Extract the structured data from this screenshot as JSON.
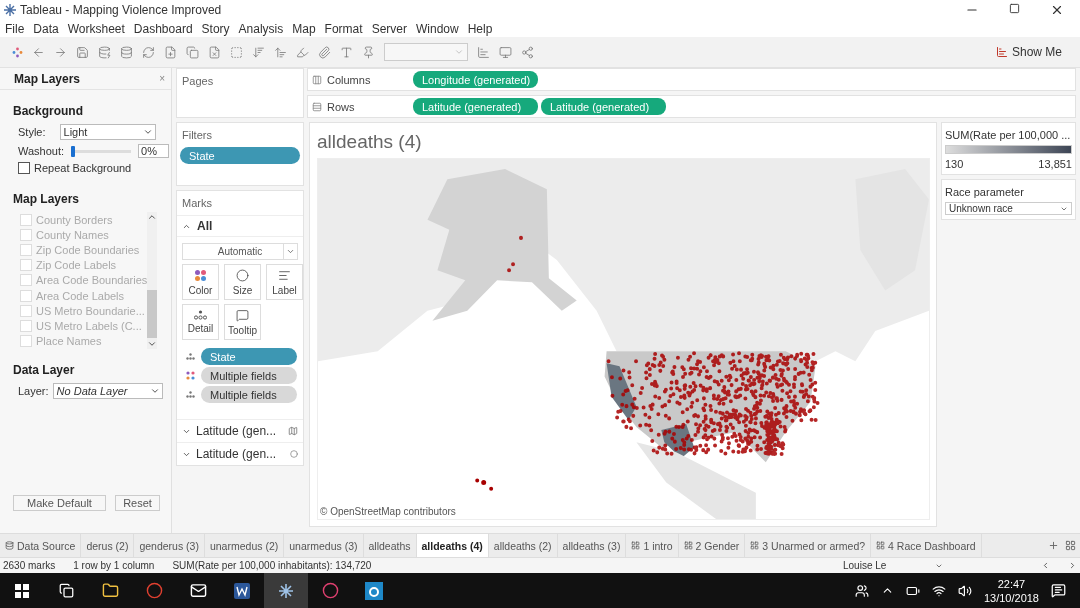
{
  "window": {
    "title": "Tableau - Mapping Violence Improved"
  },
  "menu": [
    "File",
    "Data",
    "Worksheet",
    "Dashboard",
    "Story",
    "Analysis",
    "Map",
    "Format",
    "Server",
    "Window",
    "Help"
  ],
  "toolbar": {
    "show_me": "Show Me"
  },
  "map_layers_panel": {
    "title": "Map Layers",
    "close": "×",
    "background_heading": "Background",
    "style_label": "Style:",
    "style_value": "Light",
    "washout_label": "Washout:",
    "washout": {
      "level": 0
    },
    "washout_value": "0%",
    "repeat_background": {
      "label": "Repeat Background",
      "checked": false
    },
    "layers_heading": "Map Layers",
    "layers": [
      {
        "label": "County Borders",
        "checked": false
      },
      {
        "label": "County Names",
        "checked": false
      },
      {
        "label": "Zip Code Boundaries",
        "checked": false
      },
      {
        "label": "Zip Code Labels",
        "checked": false
      },
      {
        "label": "Area Code Boundaries",
        "checked": false
      },
      {
        "label": "Area Code Labels",
        "checked": false
      },
      {
        "label": "US Metro Boundarie...",
        "checked": false
      },
      {
        "label": "US Metro Labels (C...",
        "checked": false
      },
      {
        "label": "Place Names",
        "checked": false
      }
    ],
    "data_layer_heading": "Data Layer",
    "layer_label": "Layer:",
    "layer_value": "No Data Layer",
    "buttons": [
      "Make Default",
      "Reset"
    ]
  },
  "pages": {
    "title": "Pages"
  },
  "filters": {
    "title": "Filters",
    "pills": [
      "State"
    ]
  },
  "marks": {
    "title": "Marks",
    "group": "All",
    "mark_type": "Automatic",
    "cards": [
      {
        "label": "Color",
        "kind": "color"
      },
      {
        "label": "Size",
        "kind": "size"
      },
      {
        "label": "Label",
        "kind": "label"
      },
      {
        "label": "Detail",
        "kind": "detail"
      },
      {
        "label": "Tooltip",
        "kind": "tooltip"
      }
    ],
    "pills": [
      {
        "label": "State",
        "kind": "detail",
        "color": "#3d97b3"
      },
      {
        "label": "Multiple fields",
        "kind": "color",
        "color": "#d8d8d8"
      },
      {
        "label": "Multiple fields",
        "kind": "detail",
        "color": "#d8d8d8"
      }
    ],
    "layers": [
      {
        "label": "Latitude (gen...",
        "kind": "map",
        "expanded": false
      },
      {
        "label": "Latitude (gen...",
        "kind": "circle",
        "expanded": false
      }
    ]
  },
  "shelves": [
    {
      "label": "Columns",
      "kind": "columns",
      "pills": [
        "Longitude (generated)"
      ]
    },
    {
      "label": "Rows",
      "kind": "rows",
      "pills": [
        "Latitude (generated)",
        "Latitude (generated)"
      ]
    }
  ],
  "view": {
    "title": "alldeaths (4)",
    "attribution": "© OpenStreetMap contributors"
  },
  "legend": {
    "title": "SUM(Rate per 100,000 ...",
    "min": "130",
    "max": "13,851"
  },
  "parameter": {
    "title": "Race parameter",
    "value": "Unknown race"
  },
  "sheet_tabs": [
    {
      "label": "Data Source",
      "kind": "datasource",
      "selected": false
    },
    {
      "label": "derus (2)",
      "kind": "sheet",
      "selected": false
    },
    {
      "label": "genderus (3)",
      "kind": "sheet",
      "selected": false
    },
    {
      "label": "unarmedus (2)",
      "kind": "sheet",
      "selected": false
    },
    {
      "label": "unarmedus (3)",
      "kind": "sheet",
      "selected": false
    },
    {
      "label": "alldeaths",
      "kind": "sheet",
      "selected": false
    },
    {
      "label": "alldeaths (4)",
      "kind": "sheet",
      "selected": true
    },
    {
      "label": "alldeaths (2)",
      "kind": "sheet",
      "selected": false
    },
    {
      "label": "alldeaths (3)",
      "kind": "sheet",
      "selected": false
    },
    {
      "label": "1 intro",
      "kind": "dashboard",
      "selected": false
    },
    {
      "label": "2 Gender",
      "kind": "dashboard",
      "selected": false
    },
    {
      "label": "3 Unarmed or armed?",
      "kind": "dashboard",
      "selected": false
    },
    {
      "label": "4 Race Dashboard",
      "kind": "dashboard",
      "selected": false
    }
  ],
  "status_bar": {
    "marks": "2630 marks",
    "dimensions": "1 row by 1 column",
    "sum": "SUM(Rate per 100,000 inhabitants): 134,720",
    "user": "Louise Le"
  },
  "taskbar": {
    "time": "22:47",
    "date": "13/10/2018"
  }
}
